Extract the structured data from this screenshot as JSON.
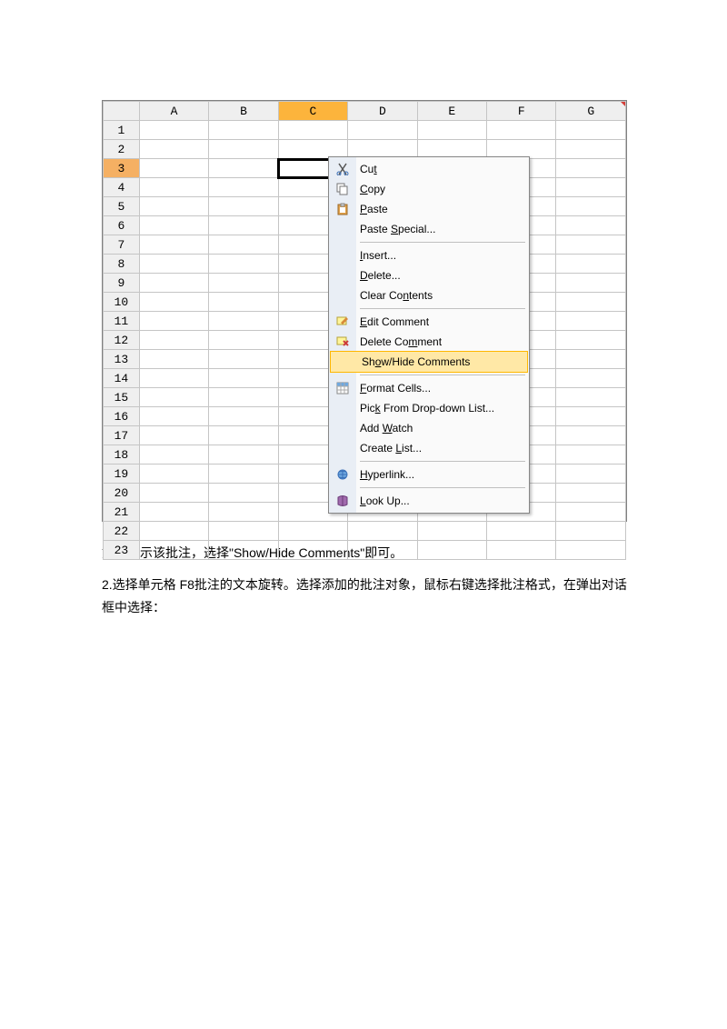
{
  "columns": [
    "A",
    "B",
    "C",
    "D",
    "E",
    "F",
    "G"
  ],
  "rows": [
    "1",
    "2",
    "3",
    "4",
    "5",
    "6",
    "7",
    "8",
    "9",
    "10",
    "11",
    "12",
    "13",
    "14",
    "15",
    "16",
    "17",
    "18",
    "19",
    "20",
    "21",
    "22",
    "23"
  ],
  "active_col": "C",
  "active_row": "3",
  "menu": {
    "cut": "Cu<u>t</u>",
    "copy": "<u>C</u>opy",
    "paste": "<u>P</u>aste",
    "pastespecial": "Paste <u>S</u>pecial...",
    "insert": "<u>I</u>nsert...",
    "delete": "<u>D</u>elete...",
    "clear": "Clear Co<u>n</u>tents",
    "editcomment": "<u>E</u>dit Comment",
    "deletecomment": "Delete Co<u>m</u>ment",
    "showhide": "Sh<u>o</u>w/Hide Comments",
    "formatcells": "<u>F</u>ormat Cells...",
    "picklist": "Pic<u>k</u> From Drop-down List...",
    "addwatch": "Add <u>W</u>atch",
    "createlist": "Create <u>L</u>ist...",
    "hyperlink": "<u>H</u>yperlink...",
    "lookup": "<u>L</u>ook Up..."
  },
  "article": {
    "p1": "如要显示该批注，选择\"Show/Hide Comments\"即可。",
    "p2": "2.选择单元格 F8批注的文本旋转。选择添加的批注对象，鼠标右键选择批注格式，在弹出对话框中选择："
  }
}
